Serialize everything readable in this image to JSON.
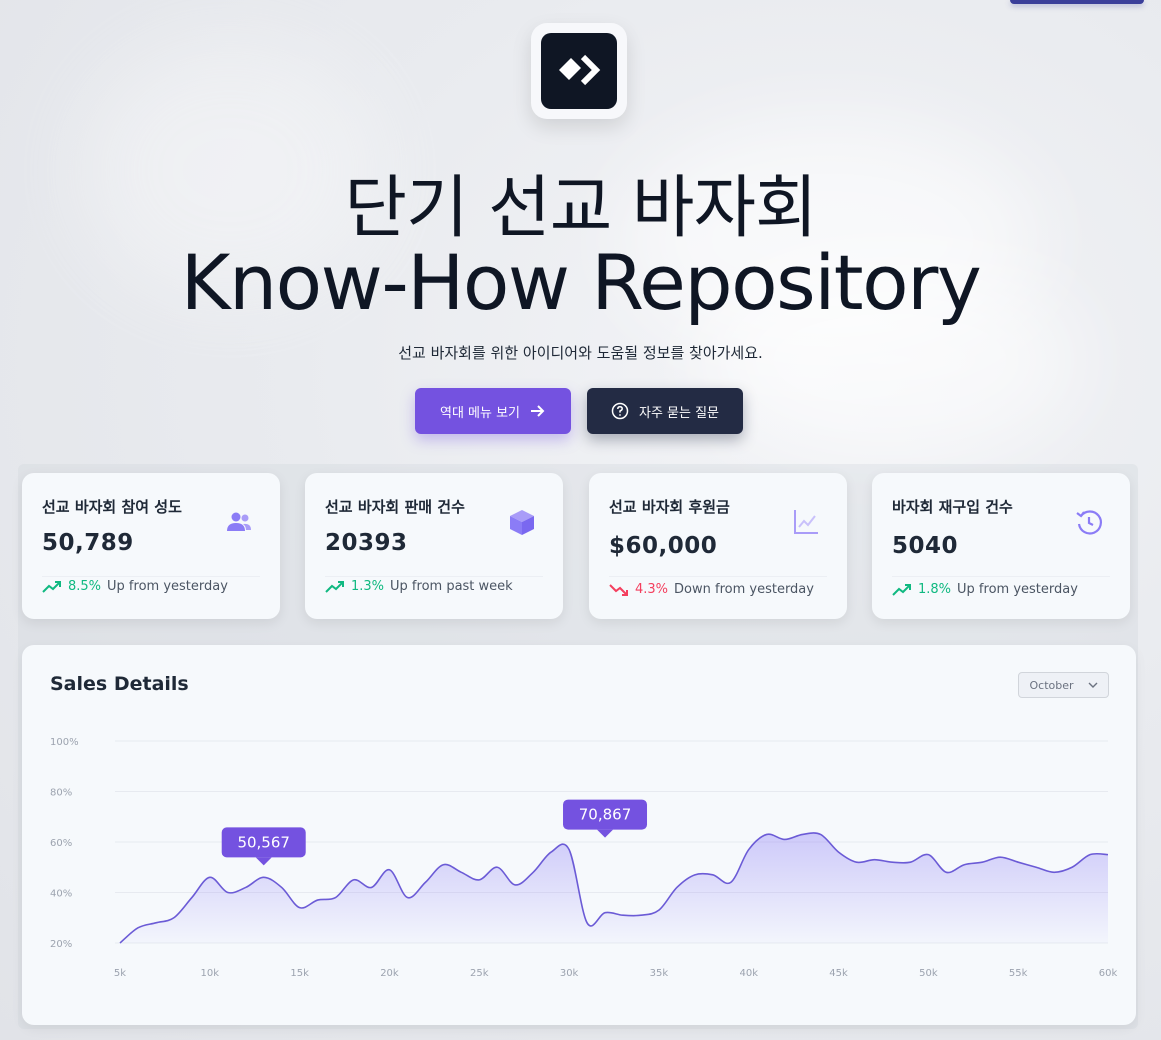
{
  "hero": {
    "title_line1": "단기 선교 바자회",
    "title_line2": "Know-How Repository",
    "subtitle": "선교 바자회를 위한 아이디어와 도움될 정보를 찾아가세요.",
    "primary_button": "역대 메뉴 보기",
    "secondary_button": "자주 묻는 질문"
  },
  "stats": [
    {
      "label": "선교 바자회 참여 성도",
      "value": "50,789",
      "change": "8.5%",
      "direction": "up",
      "note": "Up from yesterday",
      "icon": "users-icon"
    },
    {
      "label": "선교 바자회 판매 건수",
      "value": "20393",
      "change": "1.3%",
      "direction": "up",
      "note": "Up from past week",
      "icon": "box-icon"
    },
    {
      "label": "선교 바자회 후원금",
      "value": "$60,000",
      "change": "4.3%",
      "direction": "down",
      "note": "Down from yesterday",
      "icon": "line-chart-icon"
    },
    {
      "label": "바자회 재구입 건수",
      "value": "5040",
      "change": "1.8%",
      "direction": "up",
      "note": "Up from yesterday",
      "icon": "history-icon"
    }
  ],
  "colors": {
    "accent": "#7452e0",
    "dark": "#232b44",
    "up": "#10b981",
    "down": "#f43f5e",
    "line": "#6b5bd6"
  },
  "chart": {
    "title": "Sales Details",
    "month": "October"
  },
  "chart_data": {
    "type": "area",
    "title": "Sales Details",
    "x_ticks": [
      "5k",
      "10k",
      "15k",
      "20k",
      "25k",
      "30k",
      "35k",
      "40k",
      "45k",
      "50k",
      "55k",
      "60k"
    ],
    "y_ticks": [
      "100%",
      "80%",
      "60%",
      "40%",
      "20%"
    ],
    "xlim": [
      5,
      60
    ],
    "ylim": [
      20,
      100
    ],
    "x": [
      5,
      6,
      7,
      8,
      9,
      10,
      11,
      12,
      13,
      14,
      15,
      16,
      17,
      18,
      19,
      20,
      21,
      22,
      23,
      24,
      25,
      26,
      27,
      28,
      29,
      30,
      31,
      32,
      33,
      34,
      35,
      36,
      37,
      38,
      39,
      40,
      41,
      42,
      43,
      44,
      45,
      46,
      47,
      48,
      49,
      50,
      51,
      52,
      53,
      54,
      55,
      56,
      57,
      58,
      59,
      60
    ],
    "values": [
      20,
      26,
      28,
      30,
      38,
      46,
      40,
      42,
      46,
      42,
      34,
      37,
      38,
      45,
      42,
      49,
      38,
      44,
      51,
      48,
      45,
      50,
      43,
      48,
      56,
      57,
      28,
      32,
      31,
      31,
      33,
      42,
      47,
      47,
      44,
      57,
      63,
      61,
      63,
      63,
      56,
      52,
      53,
      52,
      52,
      55,
      48,
      51,
      52,
      54,
      52,
      50,
      48,
      50,
      55,
      55
    ],
    "annotations": [
      {
        "label": "50,567",
        "x": 13,
        "y": 46
      },
      {
        "label": "70,867",
        "x": 32,
        "y": 57
      }
    ]
  }
}
